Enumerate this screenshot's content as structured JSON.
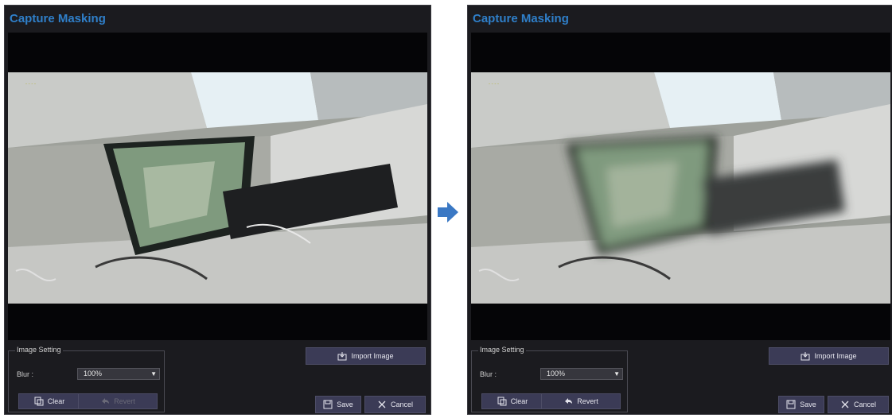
{
  "panels": [
    {
      "title": "Capture Masking",
      "state": "original",
      "image_setting": {
        "legend": "Image Setting",
        "blur_label": "Blur :",
        "blur_value": "100%",
        "clear_label": "Clear",
        "revert_label": "Revert",
        "revert_enabled": false
      },
      "import_label": "Import Image",
      "save_label": "Save",
      "cancel_label": "Cancel"
    },
    {
      "title": "Capture Masking",
      "state": "blurred",
      "image_setting": {
        "legend": "Image Setting",
        "blur_label": "Blur :",
        "blur_value": "100%",
        "clear_label": "Clear",
        "revert_label": "Revert",
        "revert_enabled": true
      },
      "import_label": "Import Image",
      "save_label": "Save",
      "cancel_label": "Cancel"
    }
  ],
  "colors": {
    "title": "#2f7fc9",
    "arrow": "#3a78c4",
    "button": "#3b3b56",
    "panel": "#1b1b1f"
  },
  "icons": [
    "copy-icon",
    "revert-icon",
    "import-icon",
    "save-icon",
    "close-icon",
    "chevron-down-icon",
    "arrow-right-icon"
  ]
}
